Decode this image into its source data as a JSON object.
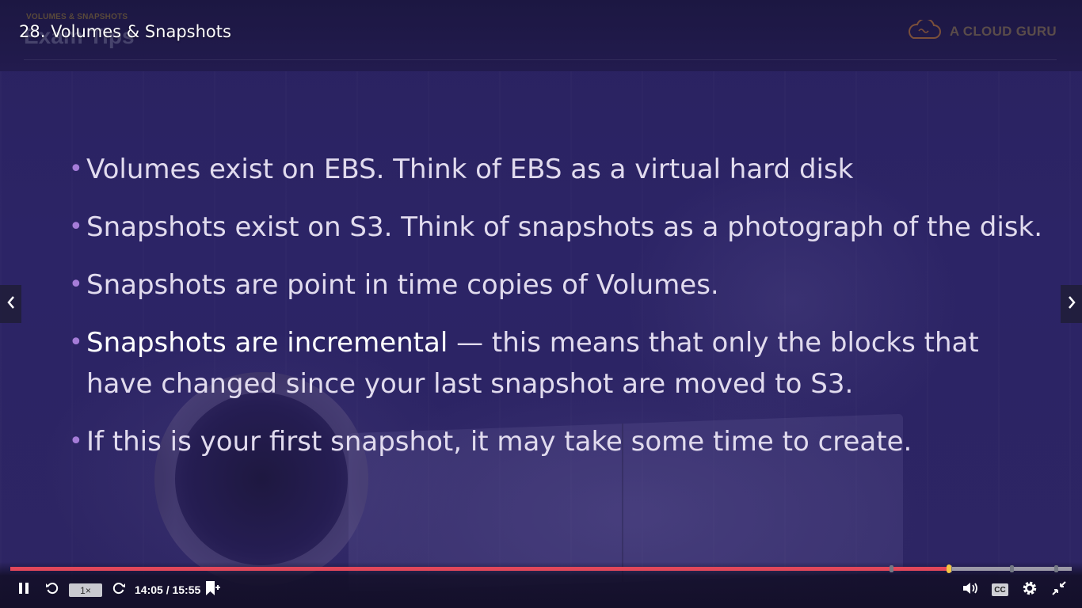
{
  "video": {
    "title": "28. Volumes & Snapshots"
  },
  "slide": {
    "kicker": "VOLUMES & SNAPSHOTS",
    "heading": "Exam Tips",
    "bullets": [
      {
        "text": "Volumes exist on EBS. Think of EBS as a virtual hard disk"
      },
      {
        "text": "Snapshots exist on S3. Think of snapshots as a photograph of the disk."
      },
      {
        "text": "Snapshots are point in time copies of Volumes."
      },
      {
        "strong": "Snapshots are incremental",
        "text": " —  this means that only the blocks that have changed since your last snapshot are moved to S3."
      },
      {
        "text": "If this is your first snapshot, it may take some time to create."
      }
    ]
  },
  "brand": {
    "name": "A CLOUD GURU",
    "color": "#5a4c4a"
  },
  "player": {
    "speed_label": "1×",
    "time_label": "14:05 / 15:55",
    "cc_label": "CC",
    "progress": 0.8847,
    "chapter_markers": [
      0.83,
      0.885,
      0.943,
      0.985
    ],
    "colors": {
      "progress": "#e2475a",
      "track": "#9c9aa8",
      "playhead": "#f4c542",
      "accent_bullet": "#a57cd8"
    }
  },
  "icons": {
    "nav_prev": "chevron-left-icon",
    "nav_next": "chevron-right-icon",
    "pause": "pause-icon",
    "rewind": "rewind-icon",
    "forward": "forward-icon",
    "bookmark": "bookmark-add-icon",
    "volume": "volume-icon",
    "settings": "gear-icon",
    "fullscreen_exit": "exit-fullscreen-icon"
  }
}
